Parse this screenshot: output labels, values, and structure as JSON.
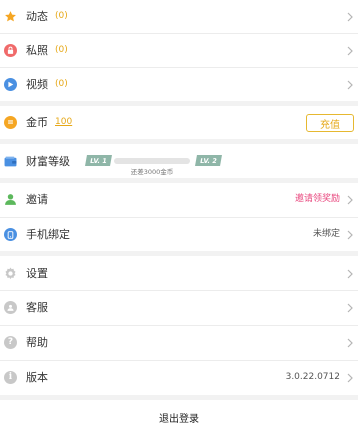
{
  "menu_group_1": [
    {
      "label": "动态",
      "count": "(0)",
      "icon": "star-icon",
      "icon_color": "#f5a623"
    },
    {
      "label": "私照",
      "count": "(0)",
      "icon": "lock-icon",
      "icon_color": "#f06a6a"
    },
    {
      "label": "视频",
      "count": "(0)",
      "icon": "play-icon",
      "icon_color": "#4a90e2"
    }
  ],
  "coins": {
    "label": "金币",
    "value": "100",
    "recharge_label": "充值",
    "icon": "coin-icon",
    "icon_color": "#f5a623"
  },
  "wealth": {
    "label": "财富等级",
    "lv_current": "LV. 1",
    "lv_next": "LV. 2",
    "hint": "还差3000金币",
    "progress": 0,
    "icon": "wallet-icon",
    "icon_color": "#4a90e2",
    "badge_color": "#8fb6a8"
  },
  "menu_group_2": [
    {
      "label": "邀请",
      "right": "邀请领奖励",
      "icon": "user-icon",
      "icon_color": "#5cb85c"
    },
    {
      "label": "手机绑定",
      "right": "未绑定",
      "icon": "phone-icon",
      "icon_color": "#4a90e2"
    }
  ],
  "menu_group_3": [
    {
      "label": "设置",
      "icon": "gear-icon",
      "icon_color": "#c8c8c8"
    },
    {
      "label": "客服",
      "icon": "service-icon",
      "icon_color": "#c8c8c8"
    },
    {
      "label": "帮助",
      "icon": "help-icon",
      "icon_color": "#c8c8c8"
    },
    {
      "label": "版本",
      "right": "3.0.22.0712",
      "icon": "info-icon",
      "icon_color": "#c8c8c8"
    }
  ],
  "logout_label": "退出登录",
  "colors": {
    "accent_gold": "#e6a817",
    "invite_pink": "#e8477e"
  }
}
